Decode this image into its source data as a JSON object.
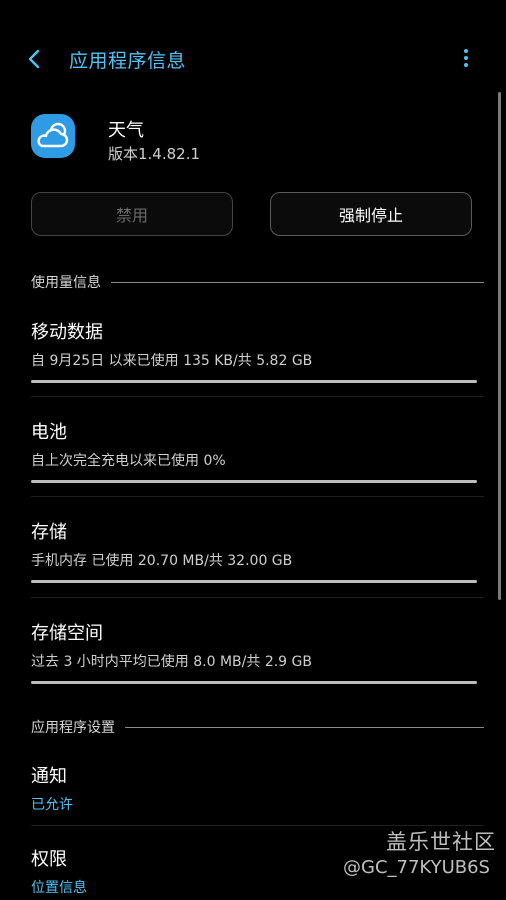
{
  "header": {
    "title": "应用程序信息",
    "back_icon": "chevron-left-icon",
    "more_icon": "vertical-dots-icon",
    "accent": "#4fc3f7"
  },
  "app": {
    "name": "天气",
    "version": "版本1.4.82.1",
    "icon": "weather-cloud-icon",
    "icon_color": "#2f9be5"
  },
  "buttons": {
    "disable": "禁用",
    "force_stop": "强制停止"
  },
  "usage_section": {
    "title": "使用量信息",
    "items": [
      {
        "title": "移动数据",
        "subtitle": "自 9月25日 以来已使用 135 KB/共 5.82 GB"
      },
      {
        "title": "电池",
        "subtitle": "自上次完全充电以来已使用 0%"
      },
      {
        "title": "存储",
        "subtitle": "手机内存 已使用 20.70 MB/共 32.00 GB"
      },
      {
        "title": "存储空间",
        "subtitle": "过去 3 小时内平均已使用 8.0 MB/共 2.9 GB"
      }
    ]
  },
  "settings_section": {
    "title": "应用程序设置",
    "items": [
      {
        "title": "通知",
        "subtitle": "已允许"
      },
      {
        "title": "权限",
        "subtitle": "位置信息"
      }
    ]
  },
  "watermark": {
    "line1": "盖乐世社区",
    "line2": "@GC_77KYUB6S"
  }
}
